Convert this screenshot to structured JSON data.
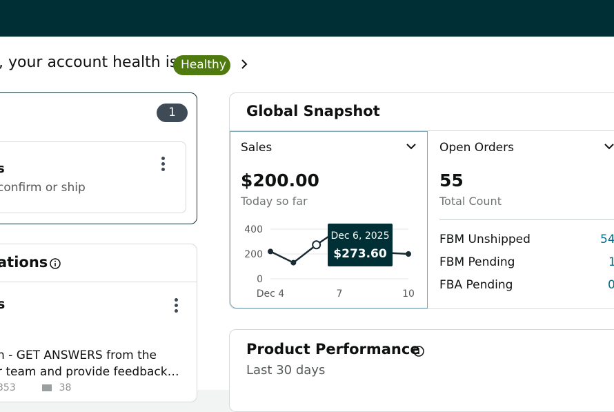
{
  "header": {
    "bar_color": "#002f36"
  },
  "health": {
    "prefix": ", your account health is",
    "badge": "Healthy",
    "badge_color": "#4f7a10"
  },
  "actions": {
    "count": "1",
    "item_title": "s",
    "item_subtitle": "confirm or ship"
  },
  "recommendations": {
    "title": "ations",
    "item_title": "s",
    "item_text_line1": "n - GET ANSWERS from the",
    "item_text_line2": "r team and provide feedback…",
    "meta_views": "353",
    "meta_comments": "38"
  },
  "snapshot": {
    "title": "Global Snapshot",
    "sales": {
      "label": "Sales",
      "value": "$200.00",
      "sub": "Today so far"
    },
    "orders": {
      "label": "Open Orders",
      "value": "55",
      "sub": "Total Count",
      "rows": [
        {
          "label": "FBM Unshipped",
          "value": "54"
        },
        {
          "label": "FBM Pending",
          "value": "1"
        },
        {
          "label": "FBA Pending",
          "value": "0"
        }
      ]
    }
  },
  "chart_data": {
    "type": "line",
    "x": [
      "Dec 4",
      "Dec 5",
      "Dec 6",
      "Dec 7",
      "Dec 8",
      "Dec 9",
      "Dec 10"
    ],
    "xtick_labels": [
      "Dec 4",
      "7",
      "10"
    ],
    "yticks": [
      "400",
      "200",
      "0"
    ],
    "ylim": [
      0,
      400
    ],
    "values": [
      220,
      130,
      273.6,
      400,
      210,
      210,
      200
    ],
    "line_color": "#1a2a33",
    "tooltip": {
      "date": "Dec 6, 2025",
      "value": "$273.60"
    },
    "grid": true
  },
  "performance": {
    "title": "Product Performance",
    "sub": "Last 30 days"
  }
}
